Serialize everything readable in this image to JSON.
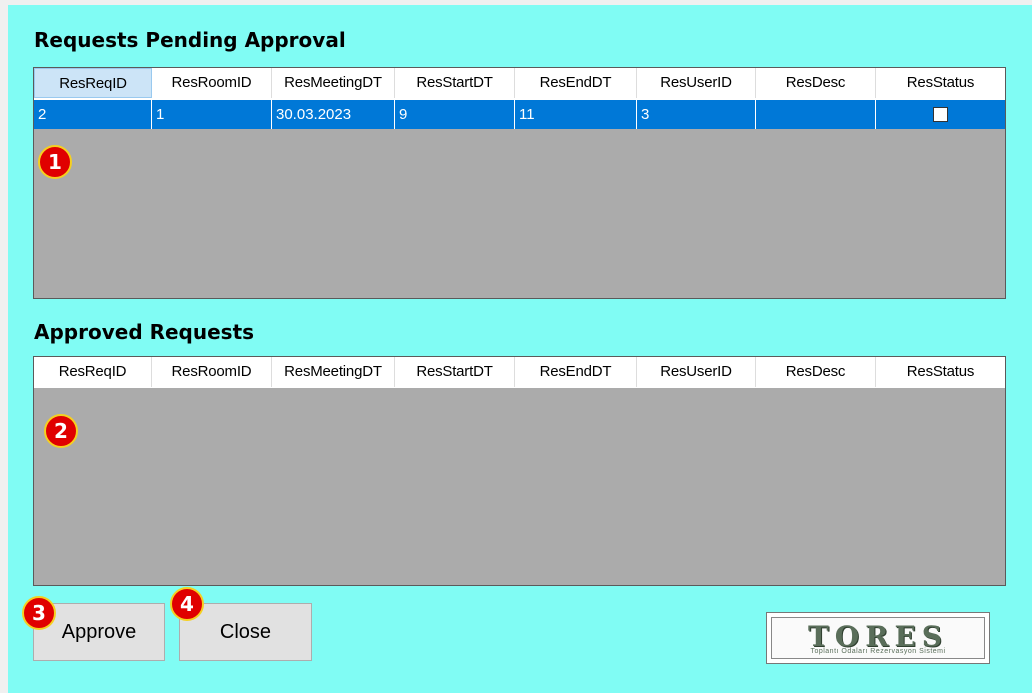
{
  "pending": {
    "title": "Requests Pending Approval",
    "columns": [
      "ResReqID",
      "ResRoomID",
      "ResMeetingDT",
      "ResStartDT",
      "ResEndDT",
      "ResUserID",
      "ResDesc",
      "ResStatus"
    ],
    "rows": [
      {
        "ResReqID": "2",
        "ResRoomID": "1",
        "ResMeetingDT": "30.03.2023",
        "ResStartDT": "9",
        "ResEndDT": "11",
        "ResUserID": "3",
        "ResDesc": "",
        "ResStatus": false
      }
    ],
    "badge": "1"
  },
  "approved": {
    "title": "Approved Requests",
    "columns": [
      "ResReqID",
      "ResRoomID",
      "ResMeetingDT",
      "ResStartDT",
      "ResEndDT",
      "ResUserID",
      "ResDesc",
      "ResStatus"
    ],
    "badge": "2"
  },
  "buttons": {
    "approve_label": "Approve",
    "approve_badge": "3",
    "close_label": "Close",
    "close_badge": "4"
  },
  "logo": {
    "title": "TORES",
    "subtitle": "Toplantı Odaları Rezervasyon Sistemi"
  },
  "colors": {
    "form_background": "#80fcf4",
    "grid_background": "#ababab",
    "selected_row": "#0078d7",
    "badge_fill": "#e00000",
    "badge_border": "#f5d020"
  }
}
